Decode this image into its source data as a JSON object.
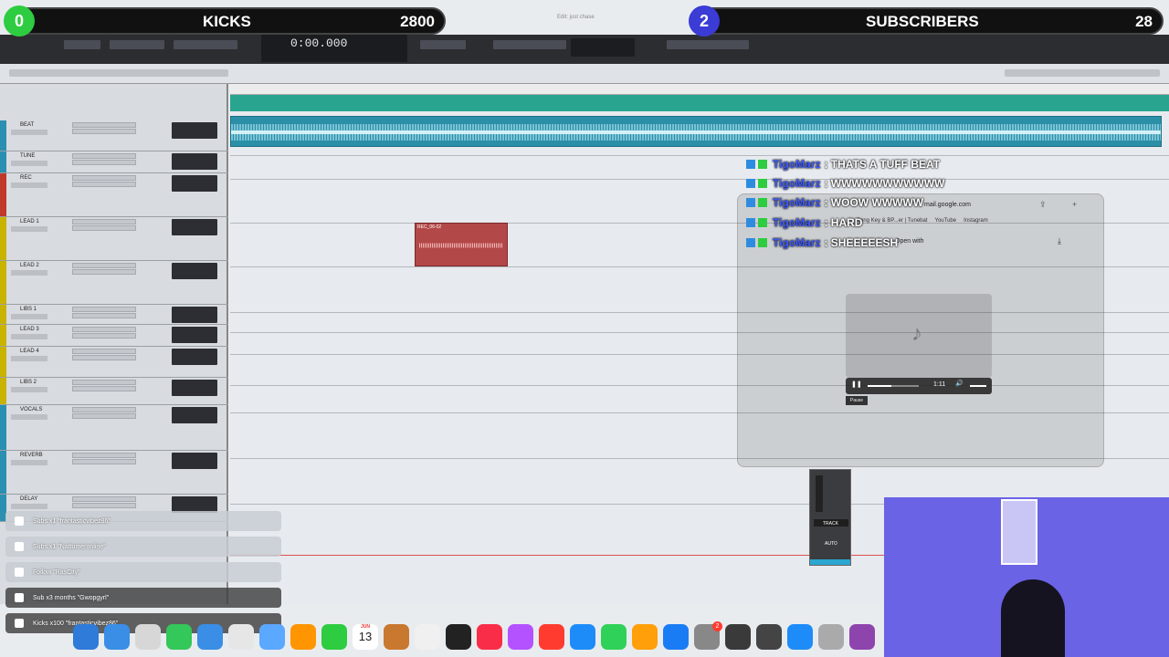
{
  "overlay": {
    "kicks": {
      "count_badge": "0",
      "label": "KICKS",
      "value": "2800"
    },
    "subscribers": {
      "count_badge": "2",
      "label": "SUBSCRIBERS",
      "value": "28"
    },
    "colors": {
      "kicks_badge": "#2ecc40",
      "subs_badge": "#3b3bd6"
    }
  },
  "daw": {
    "window_title": "Edit: just chase",
    "counter": "0:00.000",
    "tracks": [
      {
        "name": "BEAT",
        "color": "#2a8fb0"
      },
      {
        "name": "TUNE",
        "color": "#2a8fb0"
      },
      {
        "name": "REC",
        "color": "#c0392b"
      },
      {
        "name": "LEAD 1",
        "color": "#c8b400"
      },
      {
        "name": "LEAD 2",
        "color": "#c8b400"
      },
      {
        "name": "LIBS 1",
        "color": "#c8b400"
      },
      {
        "name": "LEAD 3",
        "color": "#c8b400"
      },
      {
        "name": "LEAD 4",
        "color": "#c8b400"
      },
      {
        "name": "LIBS 2",
        "color": "#c8b400"
      },
      {
        "name": "VOCALS",
        "color": "#2a8fb0"
      },
      {
        "name": "REVERB",
        "color": "#2a8fb0"
      },
      {
        "name": "DELAY",
        "color": "#2a8fb0"
      }
    ],
    "rec_clip_name": "REC_06-02",
    "float_strip": {
      "track": "TRACK",
      "auto": "AUTO"
    }
  },
  "chat": [
    {
      "user": "TigoMarz",
      "message": ": THATS A TUFF BEAT"
    },
    {
      "user": "TigoMarz",
      "message": ": WWWWWWWWWWW"
    },
    {
      "user": "TigoMarz",
      "message": ": WOOW WWWWW"
    },
    {
      "user": "TigoMarz",
      "message": ": HARD"
    },
    {
      "user": "TigoMarz",
      "message": ": SHEEEEESH"
    }
  ],
  "browser": {
    "url": "mail.google.com",
    "bookmarks": [
      "Song Key & BP...er | Tunebat",
      "YouTube",
      "Instagram"
    ],
    "open_with": "Open with",
    "media_time": "1:11",
    "pause_tooltip": "Pause"
  },
  "alerts": [
    {
      "text": "Subs x1 \"frantasticvibez86\""
    },
    {
      "text": "Subs x1 \"Nattumeronline\""
    },
    {
      "text": "Follow \"RasCity\""
    },
    {
      "text": "Sub x3 months \"Gwopgyrl\""
    },
    {
      "text": "Kicks x100 \"frantasticvibez86\""
    }
  ],
  "dock": {
    "calendar_month": "JUN",
    "calendar_day": "13",
    "notification_badge": "2"
  }
}
